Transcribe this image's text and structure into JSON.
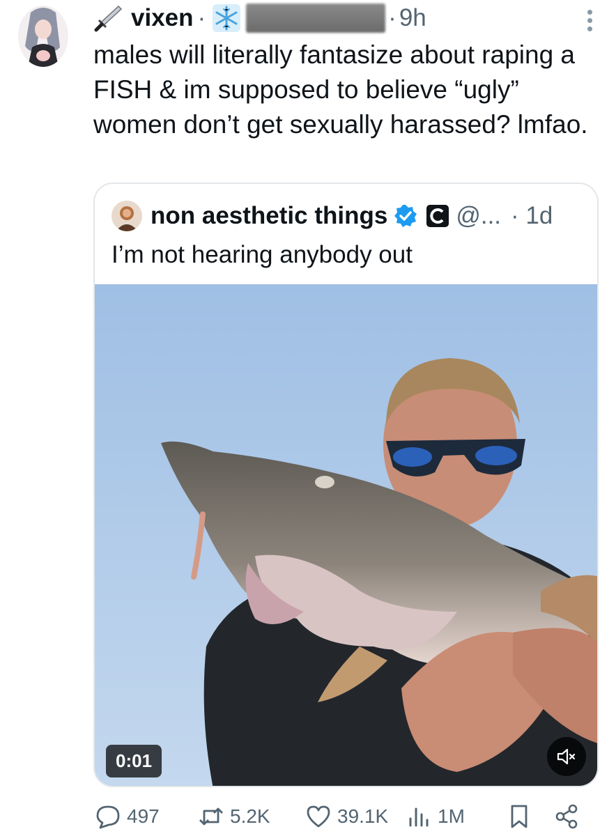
{
  "tweet": {
    "author_name": "vixen",
    "separator": "·",
    "time": "9h",
    "text": "males will literally fantasize about raping a FISH & im supposed to believe “ugly” women don’t get sexually harassed? lmfao.",
    "icons": {
      "dagger": "dagger-emoji-icon",
      "snowflake": "snowflake-emoji-icon",
      "more": "more-options-icon"
    }
  },
  "quote": {
    "author_name": "non aesthetic things",
    "handle": "@...",
    "time": "· 1d",
    "text": "I’m not hearing anybody out",
    "video": {
      "timer": "0:01",
      "muted": true
    }
  },
  "actions": {
    "replies": "497",
    "reposts": "5.2K",
    "likes": "39.1K",
    "views": "1M"
  },
  "colors": {
    "text": "#0f1419",
    "muted": "#536471",
    "verified": "#1d9bf0",
    "border": "#e3e7ea"
  }
}
